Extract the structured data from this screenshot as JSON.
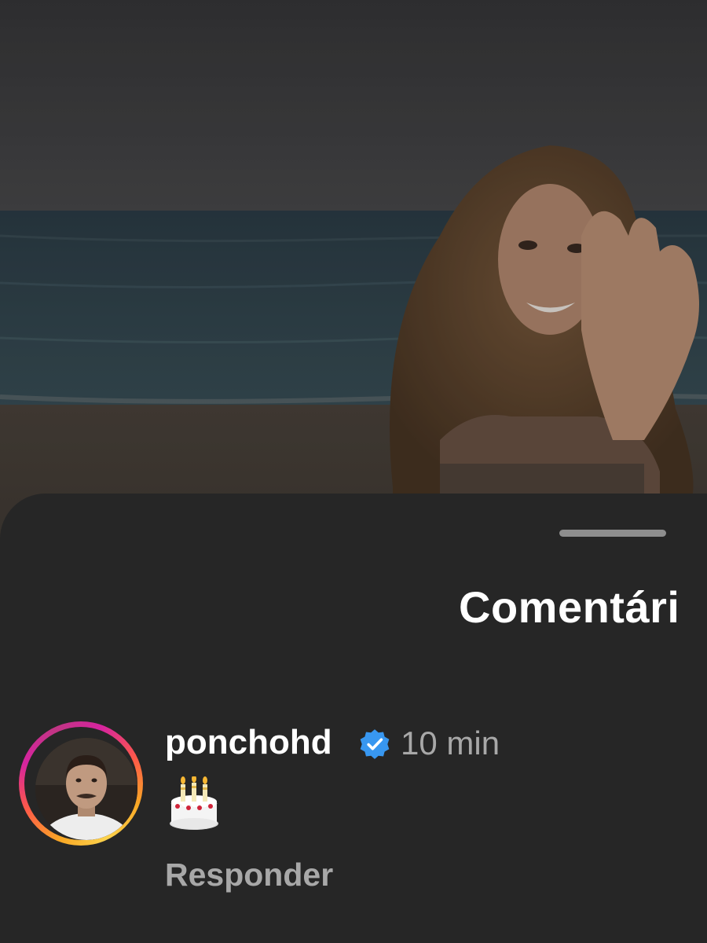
{
  "sheet": {
    "title": "Comentári"
  },
  "comment": {
    "username": "ponchohd",
    "verified": true,
    "time": "10 min",
    "text": "🎂",
    "reply_label": "Responder",
    "avatar_ring_colors": [
      "#f9a825",
      "#fd5949",
      "#d6249f"
    ]
  },
  "colors": {
    "sheet_bg": "#262626",
    "verified_blue": "#3897f0",
    "secondary_text": "#a8a8a8"
  },
  "icons": {
    "verified": "verified-badge-icon",
    "cake": "birthday-cake-emoji"
  }
}
